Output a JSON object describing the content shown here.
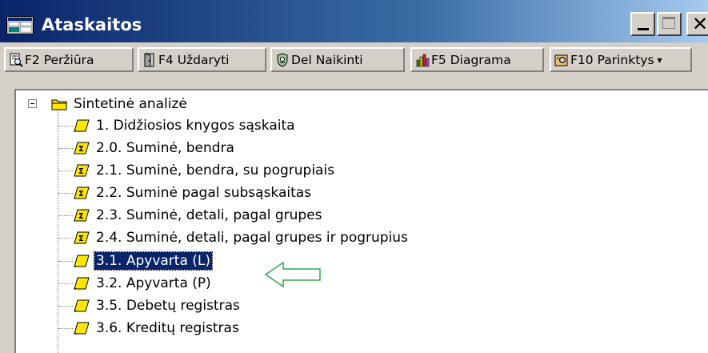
{
  "window": {
    "title": "Ataskaitos"
  },
  "titlebar": {
    "minimize_icon": "minimize-icon",
    "maximize_icon": "maximize-icon",
    "close_icon": "close-icon",
    "close_glyph": "✕"
  },
  "toolbar": {
    "buttons": [
      {
        "label": "F2 Peržiūra",
        "icon": "preview-icon"
      },
      {
        "label": "F4 Uždaryti",
        "icon": "close-door-icon"
      },
      {
        "label": "Del Naikinti",
        "icon": "delete-icon"
      },
      {
        "label": "F5 Diagrama",
        "icon": "chart-icon"
      },
      {
        "label": "F10 Parinktys",
        "icon": "settings-icon",
        "caret": "▾"
      }
    ]
  },
  "tree": {
    "root": {
      "label": "Sintetinė analizė",
      "icon": "folder-icon",
      "expanded": true
    },
    "items": [
      {
        "label": "1. Didžiosios knygos sąskaita",
        "icon": "report-icon"
      },
      {
        "label": "2.0. Suminė, bendra",
        "icon": "sum-report-icon"
      },
      {
        "label": "2.1. Suminė, bendra, su pogrupiais",
        "icon": "sum-report-icon"
      },
      {
        "label": "2.2. Suminė pagal subsąskaitas",
        "icon": "sum-report-icon"
      },
      {
        "label": "2.3. Suminė, detali, pagal grupes",
        "icon": "sum-report-icon"
      },
      {
        "label": "2.4. Suminė, detali, pagal grupes ir pogrupius",
        "icon": "sum-report-icon"
      },
      {
        "label": "3.1. Apyvarta  (L)",
        "icon": "report-icon",
        "selected": true
      },
      {
        "label": "3.2. Apyvarta  (P)",
        "icon": "report-icon"
      },
      {
        "label": "3.5. Debetų registras",
        "icon": "report-icon"
      },
      {
        "label": "3.6. Kreditų registras",
        "icon": "report-icon"
      }
    ]
  },
  "annotation": {
    "arrow_icon": "arrow-left-icon",
    "arrow_color": "#2ea84a"
  },
  "colors": {
    "titlebar_start": "#0a246a",
    "titlebar_end": "#a6caf0",
    "selection": "#0a246a",
    "folder_yellow": "#ffe600"
  }
}
